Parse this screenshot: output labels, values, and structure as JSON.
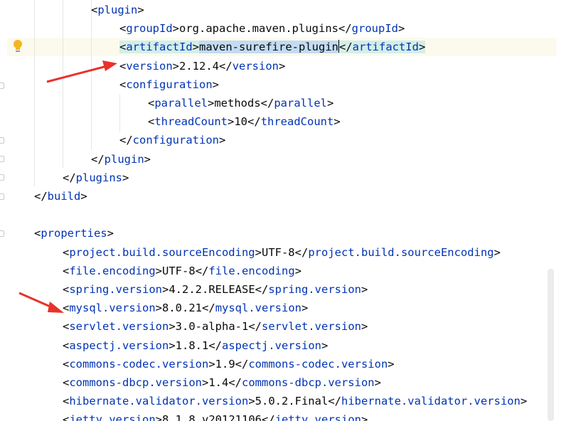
{
  "editor": {
    "lines": [
      {
        "indent": 0,
        "open": true,
        "tag": "plugin"
      },
      {
        "indent": 1,
        "tag": "groupId",
        "text": "org.apache.maven.plugins"
      },
      {
        "indent": 1,
        "tag": "artifactId",
        "text": "maven-surefire-plugin",
        "selected": true
      },
      {
        "indent": 1,
        "tag": "version",
        "text": "2.12.4"
      },
      {
        "indent": 1,
        "open": true,
        "tag": "configuration"
      },
      {
        "indent": 2,
        "tag": "parallel",
        "text": "methods"
      },
      {
        "indent": 2,
        "tag": "threadCount",
        "text": "10"
      },
      {
        "indent": 1,
        "close": true,
        "tag": "configuration"
      },
      {
        "indent": 0,
        "close": true,
        "tag": "plugin"
      },
      {
        "indent": -1,
        "close": true,
        "tag": "plugins"
      },
      {
        "indent": -2,
        "close": true,
        "tag": "build"
      },
      {
        "blank": true
      },
      {
        "indent": -2,
        "open": true,
        "tag": "properties"
      },
      {
        "indent": -1,
        "tag": "project.build.sourceEncoding",
        "text": "UTF-8"
      },
      {
        "indent": -1,
        "tag": "file.encoding",
        "text": "UTF-8"
      },
      {
        "indent": -1,
        "tag": "spring.version",
        "text": "4.2.2.RELEASE"
      },
      {
        "indent": -1,
        "tag": "mysql.version",
        "text": "8.0.21"
      },
      {
        "indent": -1,
        "tag": "servlet.version",
        "text": "3.0-alpha-1"
      },
      {
        "indent": -1,
        "tag": "aspectj.version",
        "text": "1.8.1"
      },
      {
        "indent": -1,
        "tag": "commons-codec.version",
        "text": "1.9"
      },
      {
        "indent": -1,
        "tag": "commons-dbcp.version",
        "text": "1.4"
      },
      {
        "indent": -1,
        "tag": "hibernate.validator.version",
        "text": "5.0.2.Final"
      },
      {
        "indent": -1,
        "tag": "jetty.version",
        "text": "8.1.8.v20121106"
      }
    ]
  },
  "colors": {
    "tag": "#0033b3",
    "text": "#080808",
    "current_line": "#fcfaed",
    "selection_tag": "#d3eee9",
    "selection_text": "#c3dbf2",
    "annotation_arrow": "#e8322b",
    "bulb": "#f2b822"
  },
  "icons": [
    "lightbulb-icon",
    "fold-marker-icon",
    "annotation-arrow"
  ]
}
